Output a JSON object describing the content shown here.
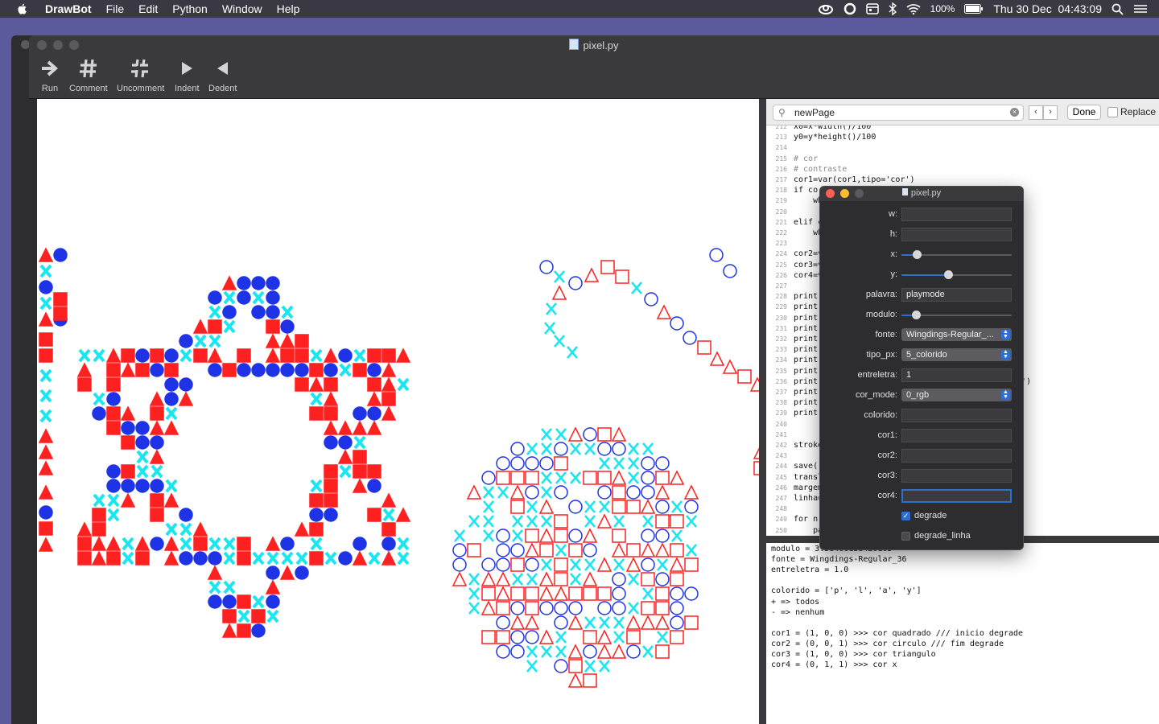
{
  "menubar": {
    "app_name": "DrawBot",
    "menus": [
      "File",
      "Edit",
      "Python",
      "Window",
      "Help"
    ],
    "battery": "100%",
    "clock": "Thu 30 Dec  04:43:09"
  },
  "window": {
    "title": "pixel.py",
    "toolbar": [
      {
        "label": "Run",
        "icon": "run-icon"
      },
      {
        "label": "Comment",
        "icon": "hash-icon"
      },
      {
        "label": "Uncomment",
        "icon": "broken-hash-icon"
      },
      {
        "label": "Indent",
        "icon": "indent-icon"
      },
      {
        "label": "Dedent",
        "icon": "dedent-icon"
      }
    ]
  },
  "find": {
    "query": "newPage",
    "done_label": "Done",
    "replace_label": "Replace"
  },
  "code": [
    {
      "n": "212",
      "t": "x0=x*width()/100"
    },
    {
      "n": "213",
      "t": "y0=y*height()/100"
    },
    {
      "n": "214",
      "t": ""
    },
    {
      "n": "215",
      "t": "# cor"
    },
    {
      "n": "216",
      "t": "# contraste"
    },
    {
      "n": "217",
      "t": "cor1=var(cor1,tipo='cor')"
    },
    {
      "n": "218",
      "t": "if co"
    },
    {
      "n": "219",
      "t": "    wh"
    },
    {
      "n": "220",
      "t": ""
    },
    {
      "n": "221",
      "t": "elif c"
    },
    {
      "n": "222",
      "t": "    wh"
    },
    {
      "n": "223",
      "t": ""
    },
    {
      "n": "224",
      "t": "cor2=v"
    },
    {
      "n": "225",
      "t": "cor3=v"
    },
    {
      "n": "226",
      "t": "cor4=v"
    },
    {
      "n": "227",
      "t": ""
    },
    {
      "n": "228",
      "t": "print("
    },
    {
      "n": "229",
      "t": "print("
    },
    {
      "n": "230",
      "t": "print("
    },
    {
      "n": "231",
      "t": "print("
    },
    {
      "n": "232",
      "t": "print("
    },
    {
      "n": "233",
      "t": "print("
    },
    {
      "n": "234",
      "t": "print("
    },
    {
      "n": "235",
      "t": "print("
    },
    {
      "n": "236",
      "t": "print(                             icio degrade')"
    },
    {
      "n": "237",
      "t": "print(                             degrade')"
    },
    {
      "n": "238",
      "t": "print("
    },
    {
      "n": "239",
      "t": "print("
    },
    {
      "n": "240",
      "t": ""
    },
    {
      "n": "241",
      "t": ""
    },
    {
      "n": "242",
      "t": "stroke"
    },
    {
      "n": "243",
      "t": ""
    },
    {
      "n": "244",
      "t": "save()"
    },
    {
      "n": "245",
      "t": "transl"
    },
    {
      "n": "246",
      "t": "margem"
    },
    {
      "n": "247",
      "t": "linha="
    },
    {
      "n": "248",
      "t": ""
    },
    {
      "n": "249",
      "t": "for n"
    },
    {
      "n": "250",
      "t": "    pa"
    }
  ],
  "output": [
    "modulo = 3.58406138420105",
    "fonte = Wingdings-Regular_36",
    "entreletra = 1.0",
    "",
    "colorido = ['p', 'l', 'a', 'y']",
    "+ => todos",
    "- => nenhum",
    "",
    "cor1 = (1, 0, 0) >>> cor quadrado /// inicio degrade",
    "cor2 = (0, 0, 1) >>> cor circulo /// fim degrade",
    "cor3 = (1, 0, 0) >>> cor triangulo",
    "cor4 = (0, 1, 1) >>> cor x"
  ],
  "variables": {
    "title": "pixel.py",
    "w_label": "w:",
    "h_label": "h:",
    "x_label": "x:",
    "x_value": 0.14,
    "y_label": "y:",
    "y_value": 0.42,
    "palavra_label": "palavra:",
    "palavra_value": "playmode",
    "modulo_label": "modulo:",
    "modulo_value": 0.13,
    "fonte_label": "fonte:",
    "fonte_value": "Wingdings-Regular_...",
    "tipo_px_label": "tipo_px:",
    "tipo_px_value": "5_colorido",
    "entreletra_label": "entreletra:",
    "entreletra_value": "1",
    "cor_mode_label": "cor_mode:",
    "cor_mode_value": "0_rgb",
    "colorido_label": "colorido:",
    "cor1_label": "cor1:",
    "cor2_label": "cor2:",
    "cor3_label": "cor3:",
    "cor4_label": "cor4:",
    "degrade_label": "degrade",
    "degrade_checked": true,
    "degrade_linha_label": "degrade_linha",
    "degrade_linha_checked": false
  },
  "colors": {
    "square": "#ff2020",
    "circle": "#1f33e6",
    "triangle": "#ff2020",
    "x": "#19e6ee",
    "accent": "#2f6fd1"
  }
}
